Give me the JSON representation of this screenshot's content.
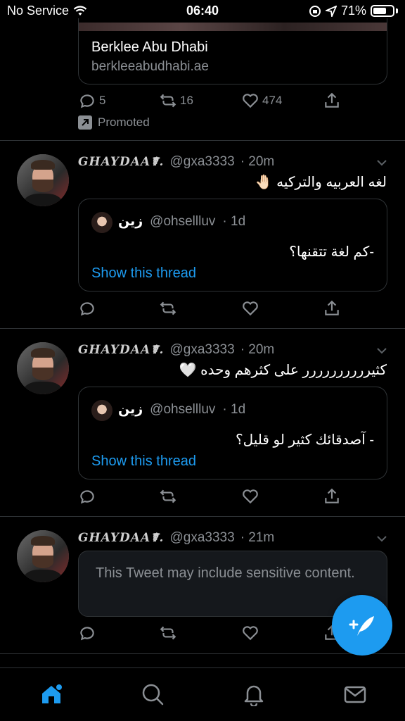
{
  "status_bar": {
    "carrier": "No Service",
    "time": "06:40",
    "battery_percent": "71%",
    "battery_level": 0.71
  },
  "promo": {
    "card_title": "Berklee Abu Dhabi",
    "card_url": "berkleeabudhabi.ae",
    "replies": "5",
    "retweets": "16",
    "likes": "474",
    "promoted_label": "Promoted"
  },
  "tweets": [
    {
      "display_name": "GHAYDAA☤.",
      "handle": "@gxa3333",
      "time": "· 20m",
      "text": "لغه العربيه والتركيه 🤚🏻",
      "quote": {
        "name": "زين",
        "handle": "@ohsellluv",
        "time": "· 1d",
        "text": "-كم لغة تتقنها؟",
        "link": "Show this thread"
      }
    },
    {
      "display_name": "GHAYDAA☤.",
      "handle": "@gxa3333",
      "time": "· 20m",
      "text": "كثيرررررررررر على كثرهم وحده 🤍",
      "quote": {
        "name": "زين",
        "handle": "@ohsellluv",
        "time": "· 1d",
        "text": "- آصدقائك كثير لو قليل؟",
        "link": "Show this thread"
      }
    },
    {
      "display_name": "GHAYDAA☤.",
      "handle": "@gxa3333",
      "time": "· 21m",
      "sensitive_notice": "This Tweet may include sensitive content."
    }
  ],
  "colors": {
    "accent": "#1d9bf0",
    "background": "#000000",
    "muted": "#8b8f94",
    "border": "#2f3336"
  },
  "tab_bar": [
    "home-icon",
    "search-icon",
    "notifications-icon",
    "messages-icon"
  ]
}
